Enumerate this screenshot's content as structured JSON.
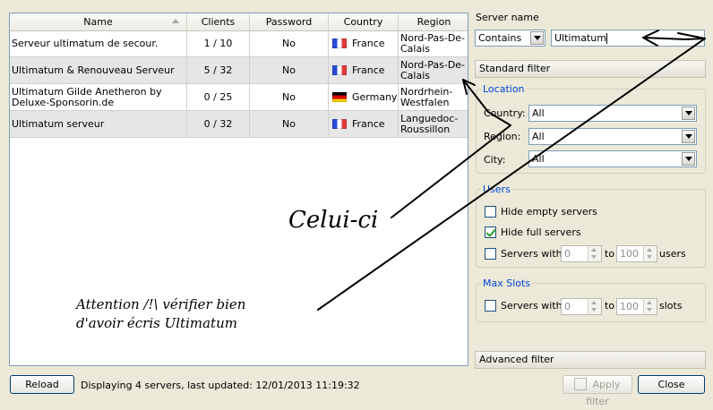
{
  "table": {
    "columns": [
      "Name",
      "Clients",
      "Password",
      "Country",
      "Region"
    ],
    "rows": [
      {
        "name": "Serveur ultimatum de secour.",
        "clients": "1 / 10",
        "password": "No",
        "country": "France",
        "flag": "fr",
        "region": "Nord-Pas-De-Calais"
      },
      {
        "name": "Ultimatum & Renouveau Serveur",
        "clients": "5 / 32",
        "password": "No",
        "country": "France",
        "flag": "fr",
        "region": "Nord-Pas-De-Calais"
      },
      {
        "name": "Ultimatum Gilde Anetheron by Deluxe-Sponsorin.de",
        "clients": "0 / 25",
        "password": "No",
        "country": "Germany",
        "flag": "de",
        "region": "Nordrhein-Westfalen"
      },
      {
        "name": "Ultimatum serveur",
        "clients": "0 / 32",
        "password": "No",
        "country": "France",
        "flag": "fr",
        "region": "Languedoc-Roussillon"
      }
    ]
  },
  "filter": {
    "server_name_label": "Server name",
    "match_mode": "Contains",
    "server_name_value": "Ultimatum",
    "standard_filter_label": "Standard filter",
    "location": {
      "title": "Location",
      "country_label": "Country:",
      "country_value": "All",
      "region_label": "Region:",
      "region_value": "All",
      "city_label": "City:",
      "city_value": "All"
    },
    "users": {
      "title": "Users",
      "hide_empty_label": "Hide empty servers",
      "hide_empty_checked": false,
      "hide_full_label": "Hide full servers",
      "hide_full_checked": true,
      "servers_with_label": "Servers with",
      "min": "0",
      "to_label": "to",
      "max": "100",
      "unit_label": "users"
    },
    "max_slots": {
      "title": "Max Slots",
      "servers_with_label": "Servers with",
      "min": "0",
      "to_label": "to",
      "max": "100",
      "unit_label": "slots"
    },
    "advanced_filter_label": "Advanced filter"
  },
  "footer": {
    "reload_label": "Reload",
    "status_text": "Displaying 4 servers, last updated: 12/01/2013 11:19:32",
    "apply_label": "Apply filter",
    "close_label": "Close"
  },
  "annotations": {
    "celui_ci": "Celui-ci",
    "attention_line1": "Attention /!\\ vérifier bien",
    "attention_line2": "d'avoir écris Ultimatum"
  }
}
